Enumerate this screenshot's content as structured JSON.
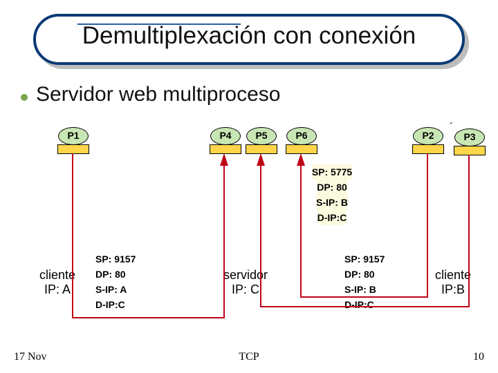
{
  "title": "Demultiplexación con conexión",
  "bullet": "Servidor web multiproceso",
  "processes": {
    "P1": "P1",
    "P2": "P2",
    "P3": "P3",
    "P4": "P4",
    "P5": "P5",
    "P6": "P6"
  },
  "hosts": {
    "clientA": {
      "line1": "cliente",
      "line2": "IP: A"
    },
    "server": {
      "line1": "servidor",
      "line2": "IP: C"
    },
    "clientB": {
      "line1": "cliente",
      "line2": "IP:B"
    }
  },
  "packets": {
    "pktA": {
      "sp": "SP: 9157",
      "dp": "DP: 80",
      "sip": "S-IP: A",
      "dip": "D-IP:C"
    },
    "pktB_1": {
      "sp": "SP: 5775",
      "dp": "DP: 80",
      "sip": "S-IP: B",
      "dip": "D-IP:C"
    },
    "pktB_2": {
      "sp": "SP: 9157",
      "dp": "DP: 80",
      "sip": "S-IP: B",
      "dip": "D-IP:C"
    }
  },
  "footer": {
    "left": "17 Nov",
    "center": "TCP",
    "right": "10"
  },
  "colors": {
    "title_border": "#0b3a75",
    "bullet": "#7aa54b",
    "process_fill": "#c8e6b4",
    "socket_fill": "#ffd54a",
    "line": "#c00018"
  }
}
